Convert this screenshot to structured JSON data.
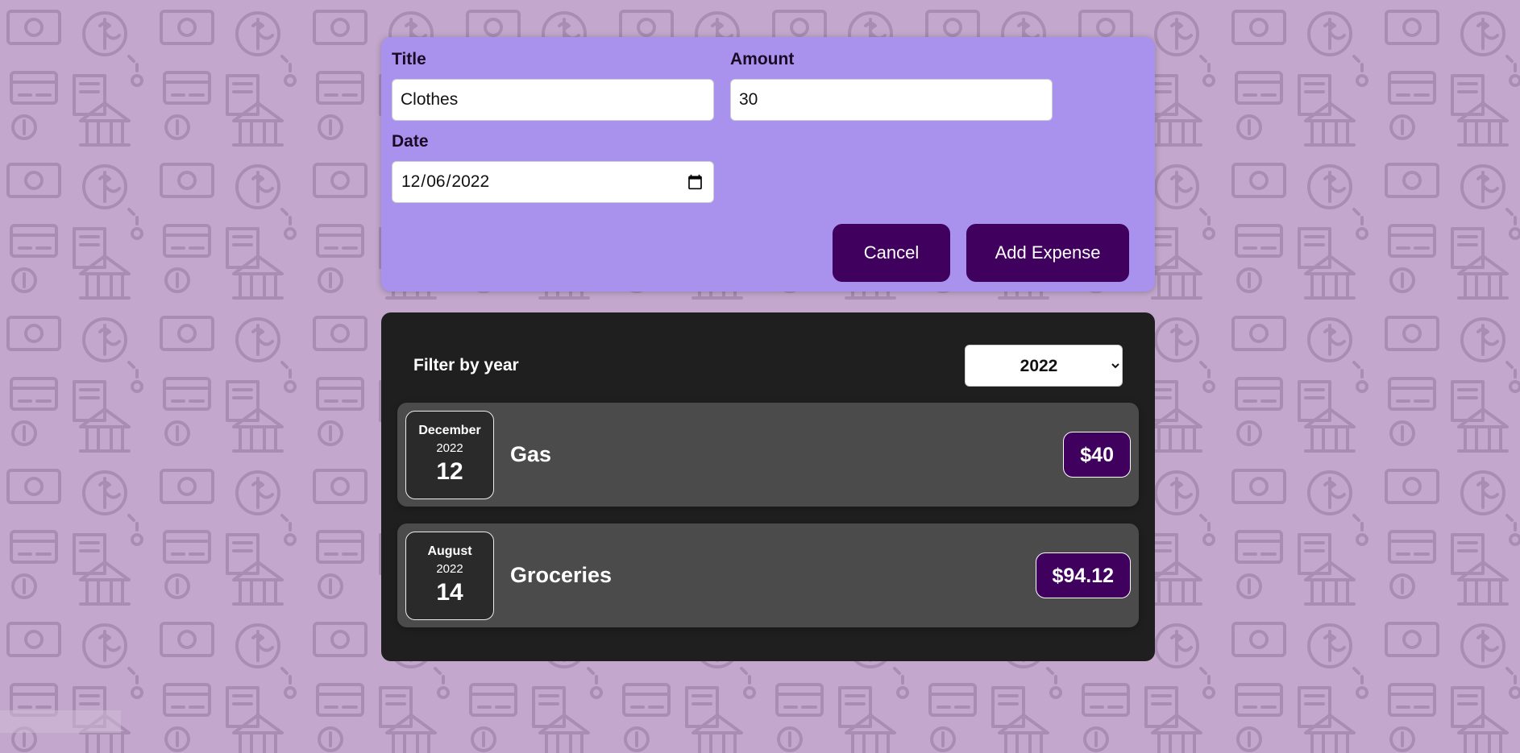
{
  "colors": {
    "background": "#c3a7cd",
    "form_panel": "#a892ee",
    "button": "#40005d",
    "list_panel": "#1f1f1f",
    "item": "#4b4b4b",
    "price_badge": "#40005d"
  },
  "form": {
    "title_label": "Title",
    "title_value": "Clothes",
    "amount_label": "Amount",
    "amount_value": "30",
    "date_label": "Date",
    "date_value": "2022-12-06",
    "date_icon": "calendar-icon",
    "cancel_label": "Cancel",
    "add_label": "Add Expense"
  },
  "filter": {
    "label": "Filter by year",
    "selected_year": "2022"
  },
  "expenses": [
    {
      "month": "December",
      "year": "2022",
      "day": "12",
      "title": "Gas",
      "amount": "$40"
    },
    {
      "month": "August",
      "year": "2022",
      "day": "14",
      "title": "Groceries",
      "amount": "$94.12"
    }
  ],
  "background_icons": "finance-pattern"
}
